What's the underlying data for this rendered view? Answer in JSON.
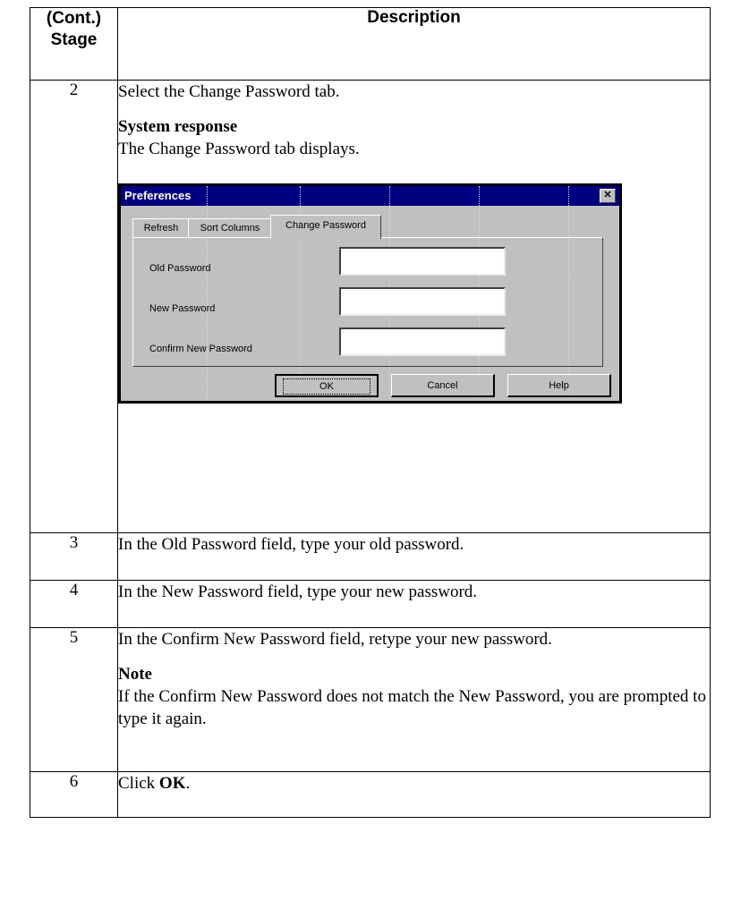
{
  "table": {
    "header": {
      "stage": "(Cont.)\nStage",
      "stage_line1": "(Cont.)",
      "stage_line2": "Stage",
      "description": "Description"
    },
    "rows": [
      {
        "stage": "2",
        "text": "Select the Change Password tab.",
        "response_heading": "System response",
        "response_text": "The Change Password tab displays."
      },
      {
        "stage": "3",
        "text": "In the Old Password field, type your old password."
      },
      {
        "stage": "4",
        "text": "In the New Password field, type your new password."
      },
      {
        "stage": "5",
        "text": "In the Confirm New Password field, retype your new password.",
        "note_heading": "Note",
        "note_text": "If the Confirm New Password does not match the New Password, you are prompted to type it again."
      },
      {
        "stage": "6",
        "text_prefix": "Click ",
        "text_bold": "OK",
        "text_suffix": "."
      }
    ]
  },
  "dialog": {
    "title": "Preferences",
    "close_glyph": "✕",
    "tabs": [
      "Refresh",
      "Sort Columns",
      "Change Password"
    ],
    "active_tab": "Change Password",
    "fields": [
      {
        "label": "Old Password",
        "value": ""
      },
      {
        "label": "New Password",
        "value": ""
      },
      {
        "label": "Confirm New Password",
        "value": ""
      }
    ],
    "buttons": {
      "ok": "OK",
      "cancel": "Cancel",
      "help": "Help"
    },
    "colors": {
      "titlebar": "#000080",
      "face": "#c0c0c0"
    }
  }
}
